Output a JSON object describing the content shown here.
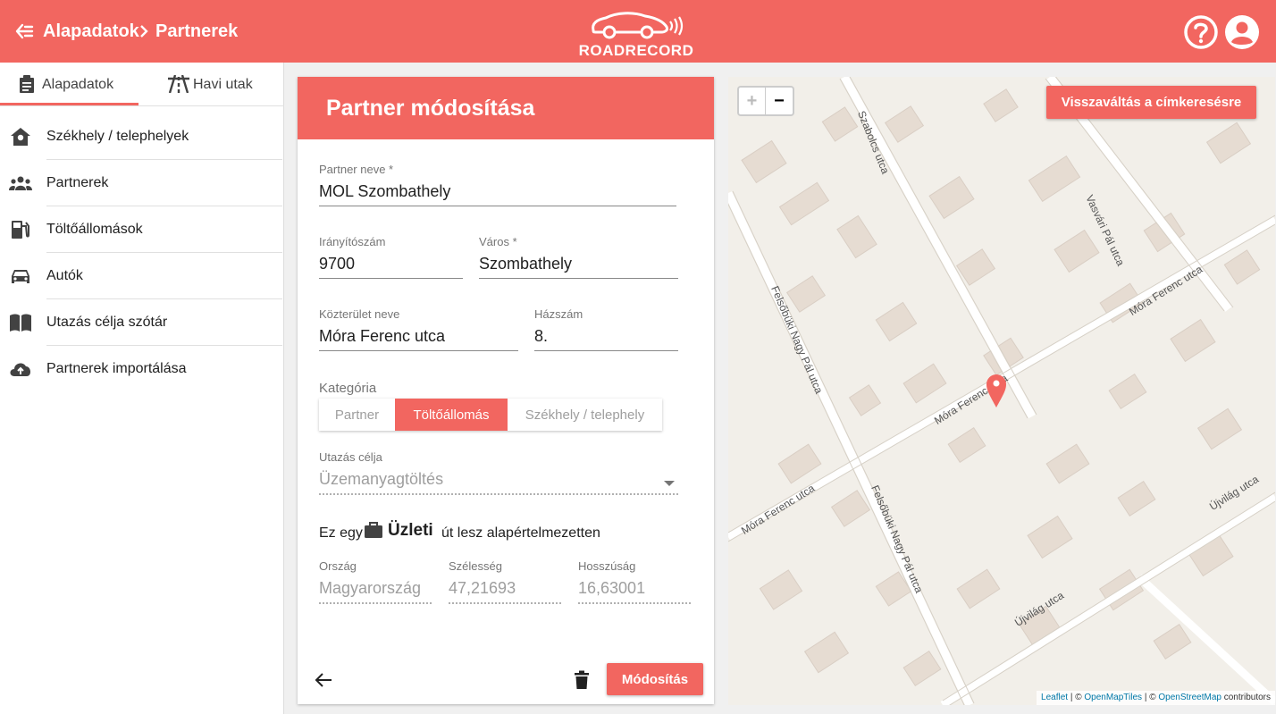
{
  "header": {
    "breadcrumb": [
      "Alapadatok",
      "Partnerek"
    ],
    "logo_text": "ROADRECORD",
    "icons": [
      "back-arrow-icon",
      "help-icon",
      "account-icon"
    ]
  },
  "sidebar": {
    "tabs": [
      {
        "label": "Alapadatok",
        "icon": "clipboard-icon",
        "active": true
      },
      {
        "label": "Havi utak",
        "icon": "road-icon",
        "active": false
      }
    ],
    "items": [
      {
        "label": "Székhely / telephelyek",
        "icon": "home-pin-icon"
      },
      {
        "label": "Partnerek",
        "icon": "people-icon"
      },
      {
        "label": "Töltőállomások",
        "icon": "fuel-pump-icon"
      },
      {
        "label": "Autók",
        "icon": "car-icon"
      },
      {
        "label": "Utazás célja szótár",
        "icon": "book-icon"
      },
      {
        "label": "Partnerek importálása",
        "icon": "cloud-upload-icon"
      }
    ]
  },
  "form": {
    "title": "Partner módosítása",
    "partner_name": {
      "label": "Partner neve *",
      "value": "MOL Szombathely"
    },
    "zip": {
      "label": "Irányítószám",
      "value": "9700"
    },
    "city": {
      "label": "Város *",
      "value": "Szombathely"
    },
    "street": {
      "label": "Közterület neve",
      "value": "Móra Ferenc utca"
    },
    "house": {
      "label": "Házszám",
      "value": "8."
    },
    "category": {
      "label": "Kategória",
      "options": [
        "Partner",
        "Töltőállomás",
        "Székhely / telephely"
      ],
      "selected": "Töltőállomás"
    },
    "purpose": {
      "label": "Utazás célja",
      "value": "Üzemanyagtöltés"
    },
    "business_line": {
      "prefix": "Ez egy",
      "type": "Üzleti",
      "suffix": "út lesz alapértelmezetten"
    },
    "country": {
      "label": "Ország",
      "value": "Magyarország"
    },
    "lat": {
      "label": "Szélesség",
      "value": "47,21693"
    },
    "lng": {
      "label": "Hosszúság",
      "value": "16,63001"
    },
    "submit_label": "Módosítás"
  },
  "map": {
    "zoom_in": "+",
    "zoom_out": "−",
    "switch_label": "Visszaváltás a címkeresésre",
    "attribution": {
      "leaflet": "Leaflet",
      "sep1": " | © ",
      "tiles": "OpenMapTiles",
      "sep2": " | © ",
      "osm": "OpenStreetMap",
      "suffix": " contributors"
    },
    "streets": [
      "Szabolcs utca",
      "Vasvári Pál utca",
      "Móra Ferenc utca",
      "Móra Ferenc utca",
      "Felsőbüki Nagy Pál utca",
      "Móra Ferenc utca",
      "Felsőbüki Nagy Pál utca",
      "Újvilág utca",
      "Újvilág utca"
    ],
    "accent": "#f26660"
  },
  "colors": {
    "brand": "#f26660"
  }
}
